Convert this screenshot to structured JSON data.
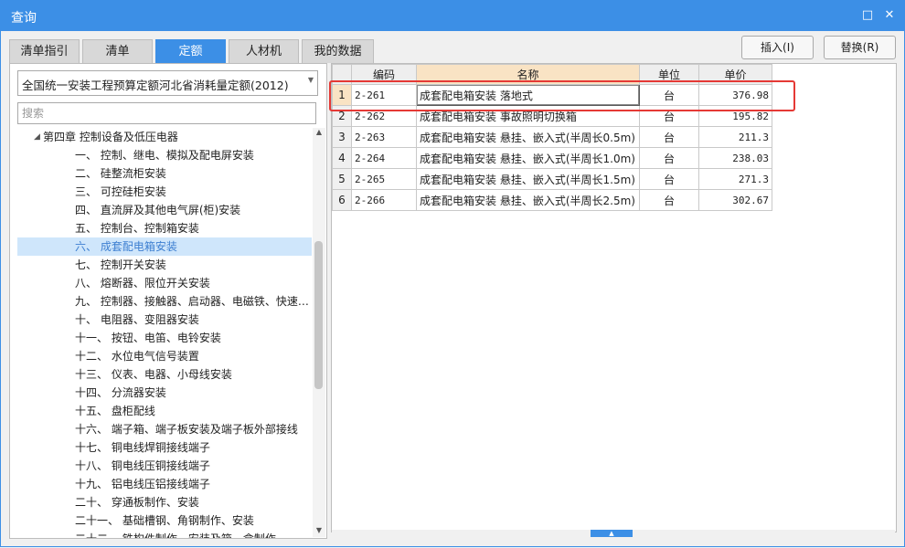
{
  "window": {
    "title": "查询",
    "maximize_icon": "□",
    "close_icon": "✕"
  },
  "tabs": [
    {
      "label": "清单指引",
      "active": false
    },
    {
      "label": "清单",
      "active": false
    },
    {
      "label": "定额",
      "active": true
    },
    {
      "label": "人材机",
      "active": false
    },
    {
      "label": "我的数据",
      "active": false
    }
  ],
  "actions": {
    "insert_label": "插入(I)",
    "replace_label": "替换(R)"
  },
  "left": {
    "quota_set": "全国统一安装工程预算定额河北省消耗量定额(2012)",
    "search_placeholder": "搜索",
    "tree": {
      "chapter": "第四章 控制设备及低压电器",
      "items": [
        "一、 控制、继电、模拟及配电屏安装",
        "二、 硅整流柜安装",
        "三、 可控硅柜安装",
        "四、 直流屏及其他电气屏(柜)安装",
        "五、 控制台、控制箱安装",
        "六、 成套配电箱安装",
        "七、 控制开关安装",
        "八、 熔断器、限位开关安装",
        "九、 控制器、接触器、启动器、电磁铁、快速…",
        "十、 电阻器、变阻器安装",
        "十一、 按钮、电笛、电铃安装",
        "十二、 水位电气信号装置",
        "十三、 仪表、电器、小母线安装",
        "十四、 分流器安装",
        "十五、 盘柜配线",
        "十六、 端子箱、端子板安装及端子板外部接线",
        "十七、 铜电线焊铜接线端子",
        "十八、 铜电线压铜接线端子",
        "十九、 铝电线压铝接线端子",
        "二十、 穿通板制作、安装",
        "二十一、 基础槽钢、角钢制作、安装",
        "二十二、 铁构件制作、安装及箱、盒制作"
      ],
      "selected_index": 5
    }
  },
  "table": {
    "columns": [
      "编码",
      "名称",
      "单位",
      "单价"
    ],
    "rows": [
      {
        "no": "1",
        "code": "2-261",
        "name": "成套配电箱安装 落地式",
        "unit": "台",
        "price": "376.98"
      },
      {
        "no": "2",
        "code": "2-262",
        "name": "成套配电箱安装 事故照明切换箱",
        "unit": "台",
        "price": "195.82"
      },
      {
        "no": "3",
        "code": "2-263",
        "name": "成套配电箱安装 悬挂、嵌入式(半周长0.5m)",
        "unit": "台",
        "price": "211.3"
      },
      {
        "no": "4",
        "code": "2-264",
        "name": "成套配电箱安装 悬挂、嵌入式(半周长1.0m)",
        "unit": "台",
        "price": "238.03"
      },
      {
        "no": "5",
        "code": "2-265",
        "name": "成套配电箱安装 悬挂、嵌入式(半周长1.5m)",
        "unit": "台",
        "price": "271.3"
      },
      {
        "no": "6",
        "code": "2-266",
        "name": "成套配电箱安装 悬挂、嵌入式(半周长2.5m)",
        "unit": "台",
        "price": "302.67"
      }
    ],
    "selected_row": 0
  },
  "colors": {
    "accent": "#3c8fe6",
    "highlight": "#e53935",
    "selected_bg": "#cfe6fb",
    "header_current": "#f9e3c4"
  }
}
